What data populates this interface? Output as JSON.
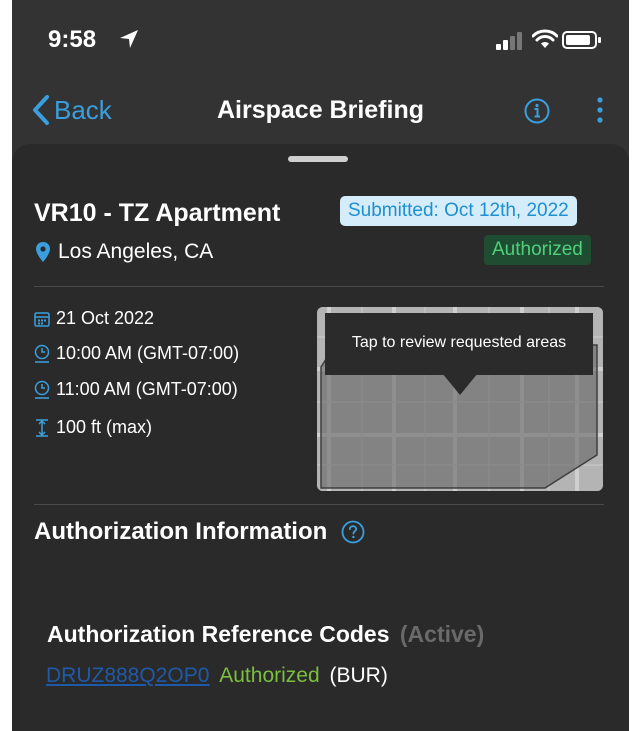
{
  "status_bar": {
    "time": "9:58"
  },
  "nav": {
    "back_label": "Back",
    "title": "Airspace Briefing"
  },
  "operation": {
    "title": "VR10 - TZ Apartment",
    "location": "Los Angeles, CA",
    "submitted_badge": "Submitted: Oct 12th, 2022",
    "status_badge": "Authorized",
    "date": "21 Oct 2022",
    "start_time": "10:00 AM (GMT-07:00)",
    "end_time": "11:00 AM (GMT-07:00)",
    "altitude": "100 ft (max)"
  },
  "map": {
    "tooltip": "Tap to review requested areas"
  },
  "authorization": {
    "section_title": "Authorization Information",
    "codes_title": "Authorization Reference Codes",
    "codes_state": "(Active)",
    "codes": [
      {
        "code": "DRUZ888Q2OP0",
        "status": "Authorized",
        "facility": "(BUR)"
      }
    ]
  },
  "colors": {
    "accent": "#3a9fde",
    "authorized_green": "#4fd17c",
    "link_blue": "#1f5aa8",
    "background": "#2a2a2a"
  },
  "icons": [
    "location-arrow-icon",
    "signal-icon",
    "wifi-icon",
    "battery-icon",
    "chevron-left-icon",
    "info-icon",
    "more-vertical-icon",
    "map-pin-icon",
    "calendar-icon",
    "clock-start-icon",
    "clock-end-icon",
    "altitude-icon",
    "help-icon"
  ]
}
